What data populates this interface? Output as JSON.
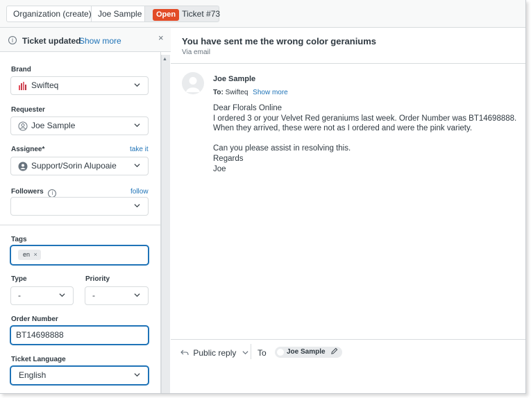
{
  "tabs": [
    {
      "label": "Organization (create)"
    },
    {
      "label": "Joe Sample"
    },
    {
      "status": "Open",
      "label": "Ticket #73"
    }
  ],
  "notice": {
    "text": "Ticket updated",
    "link": "Show more",
    "close": "×"
  },
  "fields": {
    "brand": {
      "label": "Brand",
      "value": "Swifteq"
    },
    "requester": {
      "label": "Requester",
      "value": "Joe Sample"
    },
    "assignee": {
      "label": "Assignee*",
      "action": "take it",
      "value": "Support/Sorin Alupoaie"
    },
    "followers": {
      "label": "Followers",
      "action": "follow",
      "value": ""
    },
    "tags": {
      "label": "Tags",
      "items": [
        "en"
      ]
    },
    "type": {
      "label": "Type",
      "value": "-"
    },
    "priority": {
      "label": "Priority",
      "value": "-"
    },
    "order_number": {
      "label": "Order Number",
      "value": "BT14698888"
    },
    "ticket_language": {
      "label": "Ticket Language",
      "value": "English"
    }
  },
  "ticket": {
    "subject": "You have sent me the wrong color geraniums",
    "via": "Via email",
    "sender": "Joe Sample",
    "to_label": "To:",
    "to_value": "Swifteq",
    "show_more": "Show more",
    "body_lines": [
      "Dear Florals Online",
      "I ordered 3 or your Velvet Red geraniums last week. Order Number was BT14698888.",
      "When they arrived, these were not as I ordered and were the pink variety.",
      "",
      "Can you please assist in resolving this.",
      "Regards",
      "Joe"
    ]
  },
  "reply": {
    "mode": "Public reply",
    "to_label": "To",
    "recipient": "Joe Sample"
  },
  "colors": {
    "accent": "#1f73b7",
    "open_badge": "#e24b27",
    "focus_border": "#1f73b7"
  }
}
